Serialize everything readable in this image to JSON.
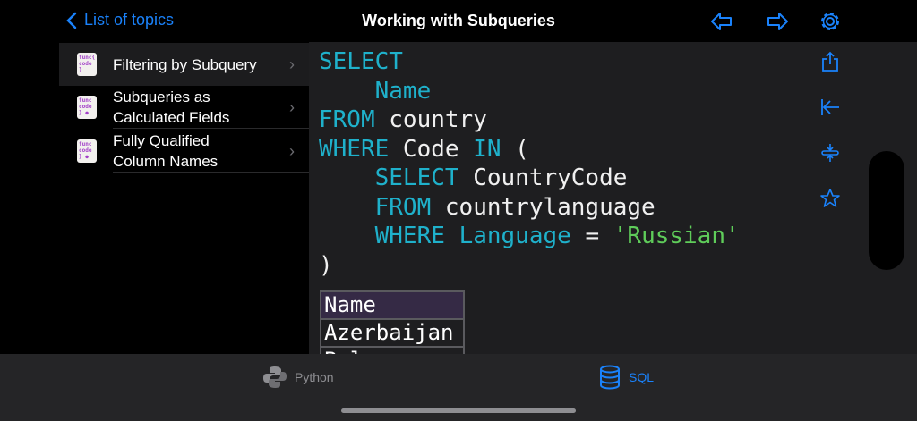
{
  "header": {
    "back_label": "List of topics",
    "title": "Working with Subqueries"
  },
  "sidebar": {
    "items": [
      {
        "label": "Filtering by Subquery",
        "selected": true,
        "locked": false
      },
      {
        "label": "Subqueries as Calculated Fields",
        "selected": false,
        "locked": true
      },
      {
        "label": "Fully Qualified Column Names",
        "selected": false,
        "locked": true
      }
    ]
  },
  "icon_text": "func{ code }",
  "code": {
    "l1": "SELECT",
    "l2": "Name",
    "l3a": "FROM",
    "l3b": " country",
    "l4a": "WHERE",
    "l4b": " Code ",
    "l4c": "IN",
    "l4d": " (",
    "l5a": "SELECT",
    "l5b": " CountryCode",
    "l6a": "FROM",
    "l6b": " countrylanguage",
    "l7a": "WHERE",
    "l7b": " ",
    "l7c": "Language",
    "l7d": " = ",
    "l7e": "'Russian'",
    "l8": ")"
  },
  "result": {
    "header": "Name",
    "rows": [
      "Azerbaijan",
      "Bel..."
    ]
  },
  "tabs": [
    {
      "label": "Python",
      "active": false
    },
    {
      "label": "SQL",
      "active": true
    }
  ],
  "colors": {
    "accent": "#1a82fb",
    "keyword": "#1fb1cb",
    "string": "#5fcd5a"
  }
}
